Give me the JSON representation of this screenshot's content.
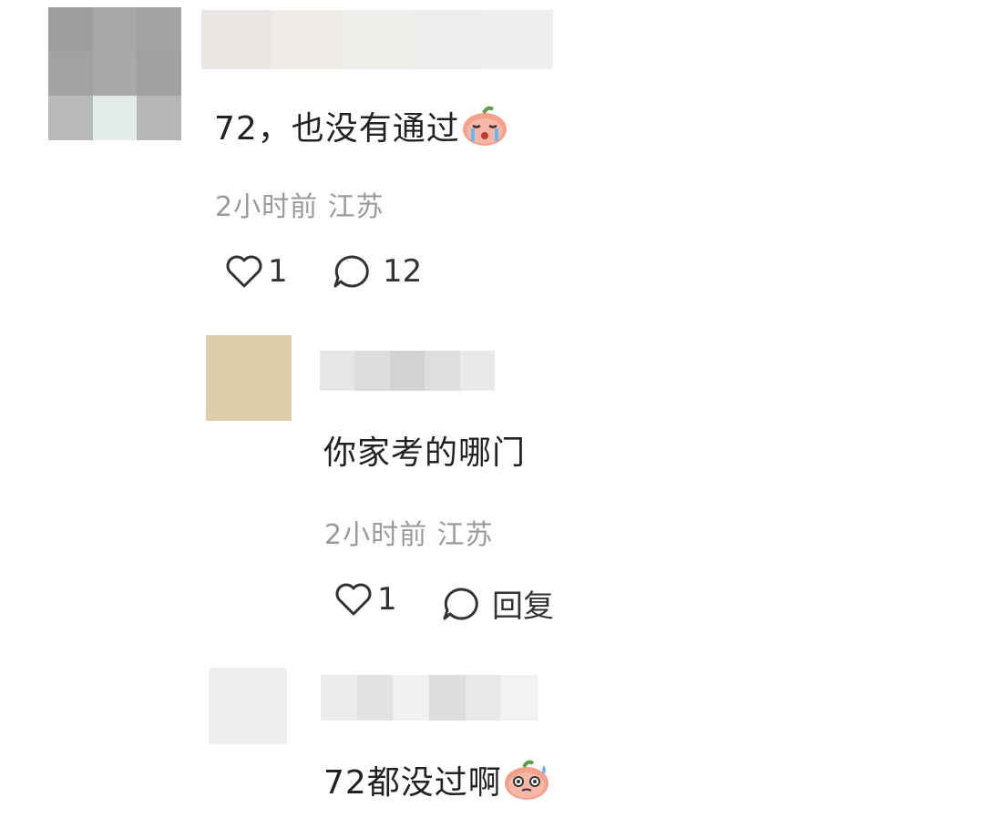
{
  "comments": [
    {
      "text": "72，也没有通过",
      "emoji": "crying-peach-emoji",
      "time": "2小时前",
      "location": "江苏",
      "likes": "1",
      "replies": "12"
    },
    {
      "text": "你家考的哪门",
      "time": "2小时前",
      "location": "江苏",
      "likes": "1",
      "reply_label": "回复"
    },
    {
      "text": "72都没过啊",
      "emoji": "sweating-peach-emoji"
    }
  ],
  "colors": {
    "meta_gray": "#9a9a9a",
    "text": "#222222",
    "emoji_peach": "#f4a08c"
  }
}
